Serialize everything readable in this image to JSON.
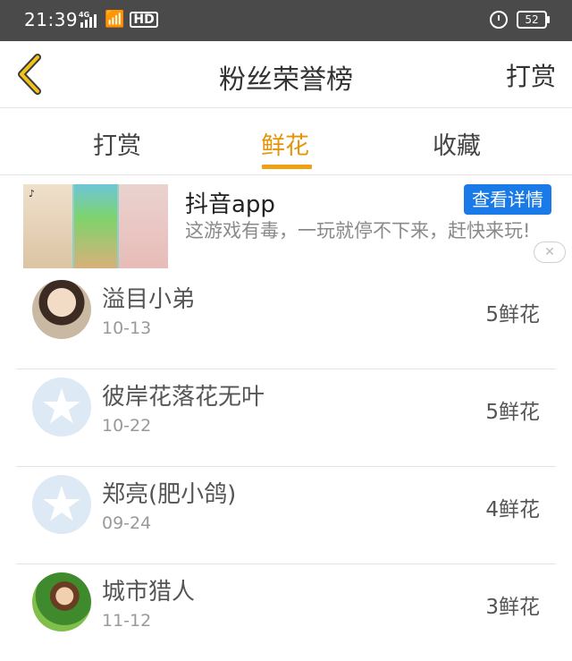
{
  "status_bar": {
    "time": "21:39",
    "network": "4G",
    "hd": "HD",
    "battery": "52"
  },
  "header": {
    "title": "粉丝荣誉榜",
    "reward_link": "打赏"
  },
  "tabs": [
    {
      "label": "打赏"
    },
    {
      "label": "鲜花"
    },
    {
      "label": "收藏"
    }
  ],
  "active_tab": 1,
  "ad": {
    "title": "抖音app",
    "detail_button": "查看详情",
    "description": "这游戏有毒，一玩就停不下来，赶快来玩!",
    "close": "✕"
  },
  "list": [
    {
      "name": "溢目小弟",
      "date": "10-13",
      "count": "5鲜花",
      "avatar": "photo-avatar"
    },
    {
      "name": "彼岸花落花无叶",
      "date": "10-22",
      "count": "5鲜花",
      "avatar": "default-avatar"
    },
    {
      "name": "郑亮(肥小鸽)",
      "date": "09-24",
      "count": "4鲜花",
      "avatar": "default-avatar"
    },
    {
      "name": "城市猎人",
      "date": "11-12",
      "count": "3鲜花",
      "avatar": "photo-avatar"
    }
  ],
  "colors": {
    "accent": "#f0a010",
    "ad_button": "#1a7ae8"
  }
}
